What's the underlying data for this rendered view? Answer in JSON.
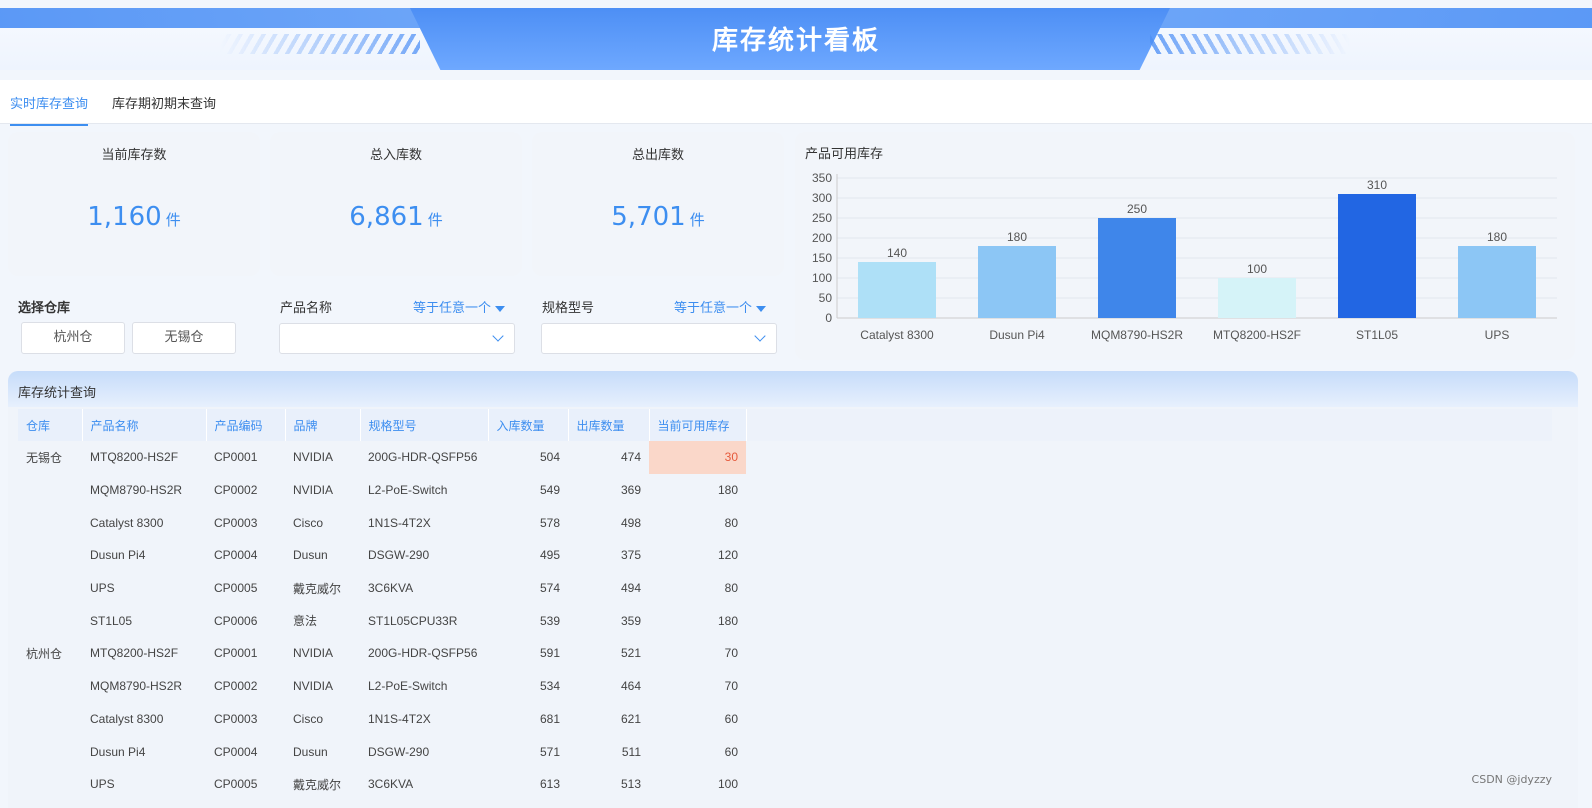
{
  "header": {
    "title": "库存统计看板"
  },
  "tabs": [
    {
      "label": "实时库存查询",
      "active": true
    },
    {
      "label": "库存期初期末查询",
      "active": false
    }
  ],
  "kpis": [
    {
      "label": "当前库存数",
      "value": "1,160",
      "unit": "件"
    },
    {
      "label": "总入库数",
      "value": "6,861",
      "unit": "件"
    },
    {
      "label": "总出库数",
      "value": "5,701",
      "unit": "件"
    }
  ],
  "filters": {
    "warehouse_title": "选择仓库",
    "warehouses": [
      "杭州仓",
      "无锡仓"
    ],
    "product_name_label": "产品名称",
    "product_name_condition": "等于任意一个",
    "spec_label": "规格型号",
    "spec_condition": "等于任意一个"
  },
  "chart_panel": {
    "title": "产品可用库存"
  },
  "chart_data": {
    "type": "bar",
    "title": "产品可用库存",
    "categories": [
      "Catalyst 8300",
      "Dusun Pi4",
      "MQM8790-HS2R",
      "MTQ8200-HS2F",
      "ST1L05",
      "UPS"
    ],
    "values": [
      140,
      180,
      250,
      100,
      310,
      180
    ],
    "ylim": [
      0,
      350
    ],
    "yticks": [
      0,
      50,
      100,
      150,
      200,
      250,
      300,
      350
    ],
    "colors": [
      "#aee0f7",
      "#8cc6f5",
      "#3f86ea",
      "#d5f3f8",
      "#2266e3",
      "#8cc6f5"
    ],
    "grid": true
  },
  "table_panel": {
    "title": "库存统计查询",
    "columns": [
      "仓库",
      "产品名称",
      "产品编码",
      "品牌",
      "规格型号",
      "入库数量",
      "出库数量",
      "当前可用库存"
    ],
    "rows": [
      [
        "无锡仓",
        "MTQ8200-HS2F",
        "CP0001",
        "NVIDIA",
        "200G-HDR-QSFP56",
        "504",
        "474",
        "30"
      ],
      [
        "",
        "MQM8790-HS2R",
        "CP0002",
        "NVIDIA",
        "L2-PoE-Switch",
        "549",
        "369",
        "180"
      ],
      [
        "",
        "Catalyst 8300",
        "CP0003",
        "Cisco",
        "1N1S-4T2X",
        "578",
        "498",
        "80"
      ],
      [
        "",
        "Dusun Pi4",
        "CP0004",
        "Dusun",
        "DSGW-290",
        "495",
        "375",
        "120"
      ],
      [
        "",
        "UPS",
        "CP0005",
        "戴克威尔",
        "3C6KVA",
        "574",
        "494",
        "80"
      ],
      [
        "",
        "ST1L05",
        "CP0006",
        "意法",
        "ST1L05CPU33R",
        "539",
        "359",
        "180"
      ],
      [
        "杭州仓",
        "MTQ8200-HS2F",
        "CP0001",
        "NVIDIA",
        "200G-HDR-QSFP56",
        "591",
        "521",
        "70"
      ],
      [
        "",
        "MQM8790-HS2R",
        "CP0002",
        "NVIDIA",
        "L2-PoE-Switch",
        "534",
        "464",
        "70"
      ],
      [
        "",
        "Catalyst 8300",
        "CP0003",
        "Cisco",
        "1N1S-4T2X",
        "681",
        "621",
        "60"
      ],
      [
        "",
        "Dusun Pi4",
        "CP0004",
        "Dusun",
        "DSGW-290",
        "571",
        "511",
        "60"
      ],
      [
        "",
        "UPS",
        "CP0005",
        "戴克威尔",
        "3C6KVA",
        "613",
        "513",
        "100"
      ]
    ],
    "alert_cells": [
      [
        0,
        7
      ]
    ]
  },
  "watermark": "CSDN @jdyzzy"
}
